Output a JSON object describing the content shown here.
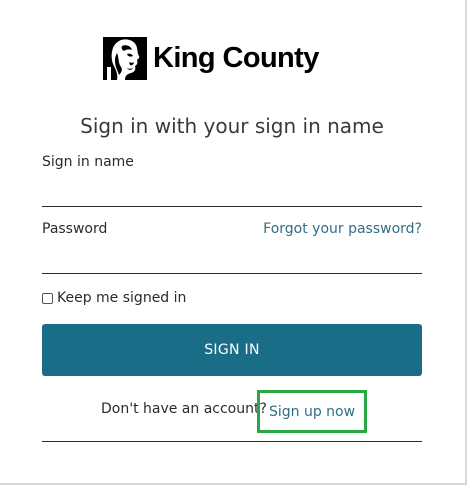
{
  "logo": {
    "text": "King County"
  },
  "form": {
    "heading": "Sign in with your sign in name",
    "signin_name_label": "Sign in name",
    "signin_name_value": "",
    "password_label": "Password",
    "password_value": "",
    "forgot_link": "Forgot your password?",
    "keep_signed_in_label": "Keep me signed in",
    "keep_signed_in_checked": false,
    "signin_button": "SIGN IN",
    "no_account_text": "Don't have an account?",
    "signup_link": "Sign up now"
  },
  "colors": {
    "button": "#1a6d87",
    "link": "#2f6e86",
    "highlight": "#27a844"
  }
}
